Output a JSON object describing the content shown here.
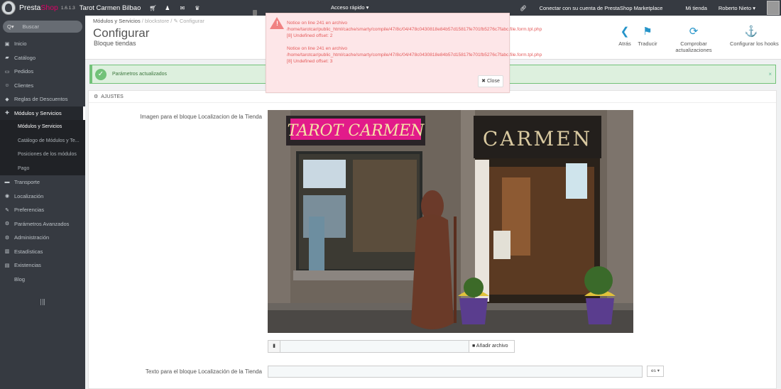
{
  "topbar": {
    "brand_presta": "Presta",
    "brand_shop": "Shop",
    "version": "1.6.1.3",
    "shop_name": "Tarot Carmen Bilbao",
    "quick_access": "Acceso rápido ▾",
    "marketplace": "Conectar con su cuenta de PrestaShop Marketplace",
    "my_shop": "Mi tienda",
    "user": "Roberto Nieto ▾"
  },
  "sidebar": {
    "search_label": "Q▾",
    "search_placeholder": "Buscar",
    "items": [
      {
        "label": "Inicio",
        "icon": "▣"
      },
      {
        "label": "Catálogo",
        "icon": "▰"
      },
      {
        "label": "Pedidos",
        "icon": "▭"
      },
      {
        "label": "Clientes",
        "icon": "☺"
      },
      {
        "label": "Reglas de Descuentos",
        "icon": "◆"
      },
      {
        "label": "Módulos y Servicios",
        "icon": "✚"
      },
      {
        "label": "Módulos y Servicios"
      },
      {
        "label": "Catálogo de Módulos y Te..."
      },
      {
        "label": "Posiciones de los módulos"
      },
      {
        "label": "Pago"
      },
      {
        "label": "Transporte",
        "icon": "▬"
      },
      {
        "label": "Localización",
        "icon": "◉"
      },
      {
        "label": "Preferencias",
        "icon": "✎"
      },
      {
        "label": "Parámetros Avanzados",
        "icon": "⚙"
      },
      {
        "label": "Administración",
        "icon": "⚙"
      },
      {
        "label": "Estadísticas",
        "icon": "▥"
      },
      {
        "label": "Existencias",
        "icon": "▤"
      },
      {
        "label": "Blog"
      }
    ]
  },
  "header": {
    "breadcrumb_1": "Módulos y Servicios",
    "breadcrumb_sep": "/",
    "breadcrumb_2": "blockstore",
    "breadcrumb_3": "✎ Configurar",
    "title": "Configurar",
    "subtitle": "Bloque tiendas",
    "toolbar": [
      {
        "label": "Atrás",
        "icon": "back-circle-icon"
      },
      {
        "label": "Traducir",
        "icon": "flag-icon"
      },
      {
        "label": "Comprobar actualizaciones",
        "icon": "refresh-icon"
      },
      {
        "label": "Configurar los hooks",
        "icon": "anchor-icon"
      }
    ]
  },
  "success_alert": {
    "text": "Parámetros actualizados",
    "close": "×"
  },
  "panel": {
    "heading": "AJUSTES",
    "image_label": "Imagen para el bloque Localizacion de la Tienda",
    "add_file": "Añadir archivo",
    "text_label": "Texto para el bloque Localización de la Tienda",
    "lang": "es ▾",
    "photo_sign_left": "TAROT CARMEN",
    "photo_sign_right": "CARMEN"
  },
  "error_modal": {
    "line1": "Notice on line 241 en archivo",
    "line2": "/home/tarotcar/public_html/cache/smarty/compile/47/8c/04/478c0430818e84b57d15817fe701fb5276c7fabc.file.form.tpl.php",
    "line3": "[8] Undefined offset: 2",
    "line4": "Notice on line 241 en archivo",
    "line5": "/home/tarotcar/public_html/cache/smarty/compile/47/8c/04/478c0430818e84b57d15817fe701fb5276c7fabc.file.form.tpl.php",
    "line6": "[8] Undefined offset: 3",
    "close": "✖ Close"
  },
  "colors": {
    "sidebar": "#363a41",
    "accent": "#2594c9",
    "success": "#72c279",
    "error_text": "#e45b5b",
    "brand_pink": "#df0067"
  }
}
